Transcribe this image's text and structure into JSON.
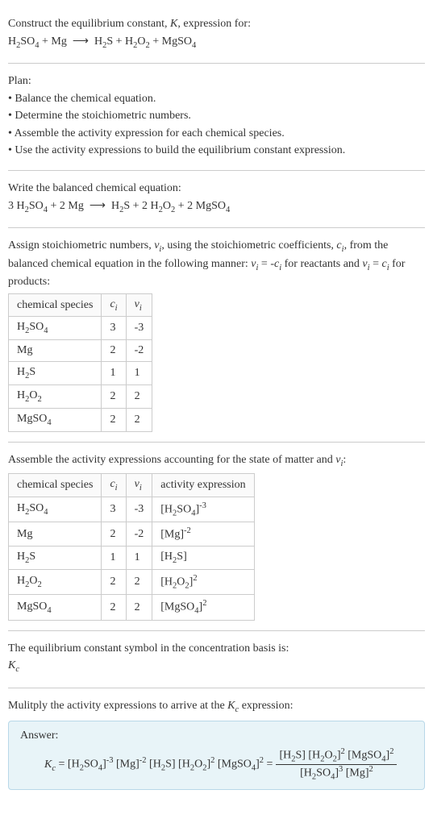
{
  "header": {
    "line1": "Construct the equilibrium constant, K, expression for:",
    "equation": "H₂SO₄ + Mg ⟶ H₂S + H₂O₂ + MgSO₄"
  },
  "plan": {
    "title": "Plan:",
    "items": [
      "• Balance the chemical equation.",
      "• Determine the stoichiometric numbers.",
      "• Assemble the activity expression for each chemical species.",
      "• Use the activity expressions to build the equilibrium constant expression."
    ]
  },
  "balanced": {
    "title": "Write the balanced chemical equation:",
    "equation": "3 H₂SO₄ + 2 Mg ⟶ H₂S + 2 H₂O₂ + 2 MgSO₄"
  },
  "stoich": {
    "intro": "Assign stoichiometric numbers, νᵢ, using the stoichiometric coefficients, cᵢ, from the balanced chemical equation in the following manner: νᵢ = -cᵢ for reactants and νᵢ = cᵢ for products:",
    "headers": [
      "chemical species",
      "cᵢ",
      "νᵢ"
    ],
    "rows": [
      [
        "H₂SO₄",
        "3",
        "-3"
      ],
      [
        "Mg",
        "2",
        "-2"
      ],
      [
        "H₂S",
        "1",
        "1"
      ],
      [
        "H₂O₂",
        "2",
        "2"
      ],
      [
        "MgSO₄",
        "2",
        "2"
      ]
    ]
  },
  "activity": {
    "intro": "Assemble the activity expressions accounting for the state of matter and νᵢ:",
    "headers": [
      "chemical species",
      "cᵢ",
      "νᵢ",
      "activity expression"
    ],
    "rows": [
      [
        "H₂SO₄",
        "3",
        "-3",
        "[H₂SO₄]⁻³"
      ],
      [
        "Mg",
        "2",
        "-2",
        "[Mg]⁻²"
      ],
      [
        "H₂S",
        "1",
        "1",
        "[H₂S]"
      ],
      [
        "H₂O₂",
        "2",
        "2",
        "[H₂O₂]²"
      ],
      [
        "MgSO₄",
        "2",
        "2",
        "[MgSO₄]²"
      ]
    ]
  },
  "eqconst": {
    "line1": "The equilibrium constant symbol in the concentration basis is:",
    "symbol": "K_c"
  },
  "multiply": {
    "intro": "Mulitply the activity expressions to arrive at the K_c expression:"
  },
  "answer": {
    "label": "Answer:",
    "lhs": "K_c = [H₂SO₄]⁻³ [Mg]⁻² [H₂S] [H₂O₂]² [MgSO₄]² = ",
    "num": "[H₂S] [H₂O₂]² [MgSO₄]²",
    "den": "[H₂SO₄]³ [Mg]²"
  }
}
